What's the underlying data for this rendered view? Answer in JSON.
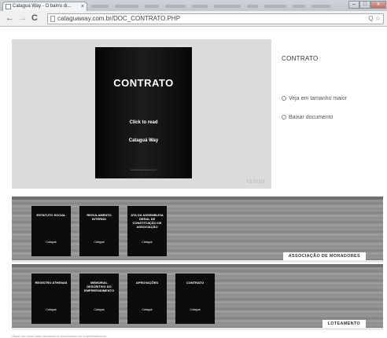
{
  "browser": {
    "tab_title": "Cataguá Way - O bairro di...",
    "tab_close": "×",
    "back": "←",
    "forward": "→",
    "reload": "C",
    "url": "cataguaway.com.br/DOC_CONTRATO.PHP",
    "tool_icons": "Q ☆",
    "window_controls": {
      "minimize": "–",
      "maximize": "□",
      "close": "x"
    }
  },
  "viewer": {
    "cover_title": "CONTRATO",
    "cover_cta": "Click to read",
    "cover_logo": "Cataguá Way",
    "cover_footer": "www.cataguaway.com.br",
    "watermark": "issuu"
  },
  "sidebar": {
    "title": "CONTRATO",
    "links": [
      "Veja em tamanho maior",
      "Baixar documento"
    ]
  },
  "shelves": [
    {
      "label": "ASSOCIAÇÃO DE MORADORES",
      "docs": [
        "ESTATUTO SOCIAL",
        "REGULAMENTO INTERNO",
        "ATA DA ASSEMBLEIA GERAL DE CONSTITUIÇÃO DE ASSOCIAÇÃO"
      ]
    },
    {
      "label": "LOTEAMENTO",
      "docs": [
        "REGISTRO ATHENAS",
        "MEMORIAL DESCRITIVO DO EMPREENDIMENTO",
        "APROVAÇÕES",
        "CONTRATO"
      ]
    }
  ],
  "doc_logo": "Cataguá",
  "footer_text": "Clique nos livros para visualizar os documentos do empreendimento"
}
